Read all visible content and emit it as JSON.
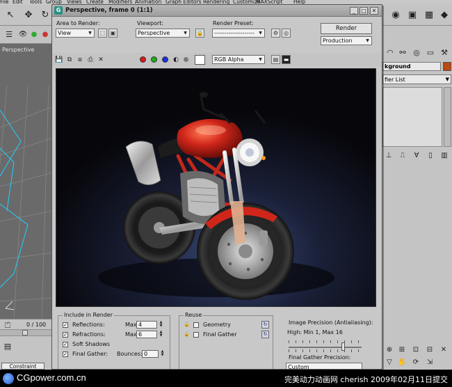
{
  "max_menu": [
    "File",
    "Edit",
    "Tools",
    "Group",
    "Views",
    "Create",
    "Modifiers",
    "Animation",
    "Graph Editors",
    "Rendering",
    "Customize",
    "MAXScript",
    "Help"
  ],
  "left_viewport": {
    "label": "Perspective"
  },
  "timeline": {
    "frame_counter": "0 / 100"
  },
  "status": {
    "constraint": "Constraint"
  },
  "right_panel": {
    "name_field": "kground",
    "modifier_list": "fier List",
    "accent_color": "#b94a12"
  },
  "render_window": {
    "title": "Perspective, frame 0 (1:1)",
    "area_to_render_label": "Area to Render:",
    "area_to_render_value": "View",
    "viewport_label": "Viewport:",
    "viewport_value": "Perspective",
    "render_preset_label": "Render Preset:",
    "render_preset_value": "--------------------",
    "render_button": "Render",
    "production_value": "Production",
    "channel_value": "RGB Alpha",
    "channel_colors": {
      "red": "#e01818",
      "green": "#18b018",
      "blue": "#1830e0",
      "mono": "#7a7a7a"
    },
    "render_subject": "motorcycle render"
  },
  "settings": {
    "include_in_render": {
      "title": "Include in Render",
      "reflections": {
        "label": "Reflections:",
        "checked": true,
        "max_label": "Max",
        "max_value": "4"
      },
      "refractions": {
        "label": "Refractions:",
        "checked": true,
        "max_label": "Max",
        "max_value": "6"
      },
      "soft_shadows": {
        "label": "Soft Shadows",
        "checked": true
      },
      "final_gather": {
        "label": "Final Gather:",
        "checked": true,
        "bounces_label": "Bounces:",
        "bounces_value": "0"
      }
    },
    "reuse": {
      "title": "Reuse",
      "geometry": {
        "label": "Geometry",
        "checked": false
      },
      "final_gather": {
        "label": "Final Gather",
        "checked": false
      }
    },
    "precision": {
      "title": "Image Precision (Antialiasing):",
      "value": "High: Min 1, Max 16",
      "slider_fraction": 0.75,
      "fg_precision_title": "Final Gather Precision:",
      "fg_precision_value": "Custom"
    }
  },
  "watermark": {
    "site": "CGpower.com.cn",
    "credit": "完美动力动画网 cherish 2009年02月11日提交"
  }
}
